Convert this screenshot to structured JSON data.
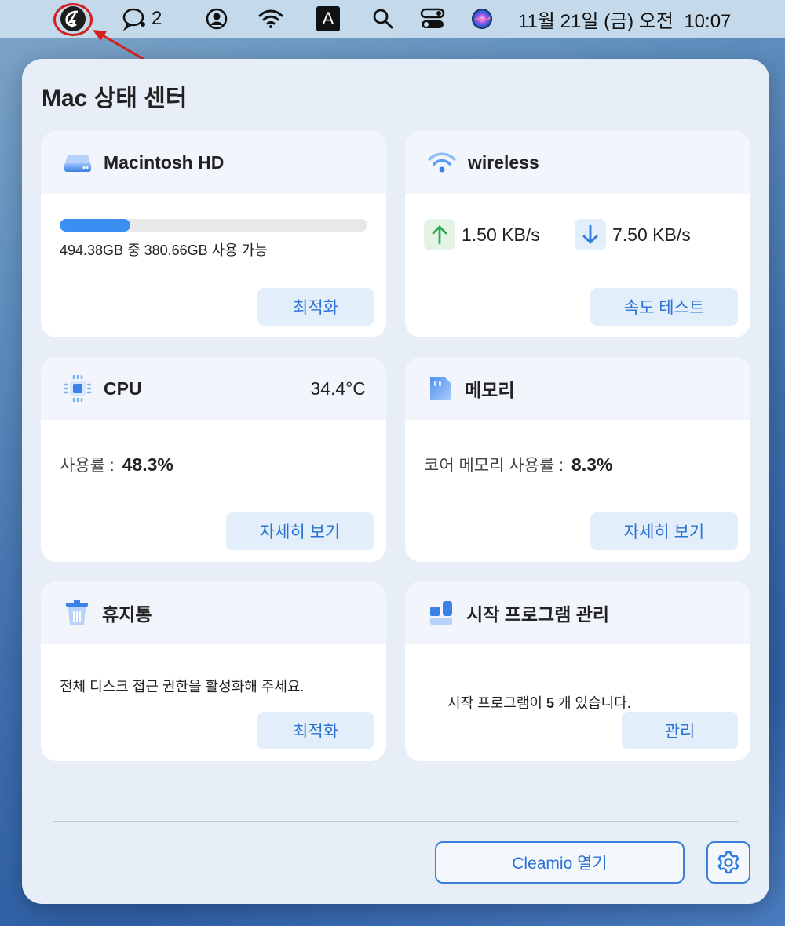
{
  "menubar": {
    "messages_count": "2",
    "input_source": "A",
    "datetime": "11월 21일 (금) 오전  10:07"
  },
  "panel": {
    "title": "Mac 상태 센터",
    "disk": {
      "title": "Macintosh HD",
      "usage_text": "494.38GB 중 380.66GB 사용 가능",
      "used_fraction": 0.23,
      "button": "최적화"
    },
    "network": {
      "title": "wireless",
      "upload": "1.50 KB/s",
      "download": "7.50 KB/s",
      "button": "속도 테스트"
    },
    "cpu": {
      "title": "CPU",
      "temperature": "34.4°C",
      "usage_label": "사용률 :",
      "usage_value": "48.3%",
      "button": "자세히 보기"
    },
    "memory": {
      "title": "메모리",
      "usage_label": "코어 메모리 사용률 :",
      "usage_value": "8.3%",
      "button": "자세히 보기"
    },
    "trash": {
      "title": "휴지통",
      "message": "전체 디스크 접근 권한을 활성화해 주세요.",
      "button": "최적화"
    },
    "startup": {
      "title": "시작 프로그램 관리",
      "msg_before": "시작 프로그램이 ",
      "count": "5",
      "msg_after": " 개 있습니다.",
      "button": "관리"
    },
    "open_button": "Cleamio 열기"
  },
  "colors": {
    "accent": "#2b72d3",
    "button_bg": "#e3eefb",
    "annotation": "#d42020"
  }
}
